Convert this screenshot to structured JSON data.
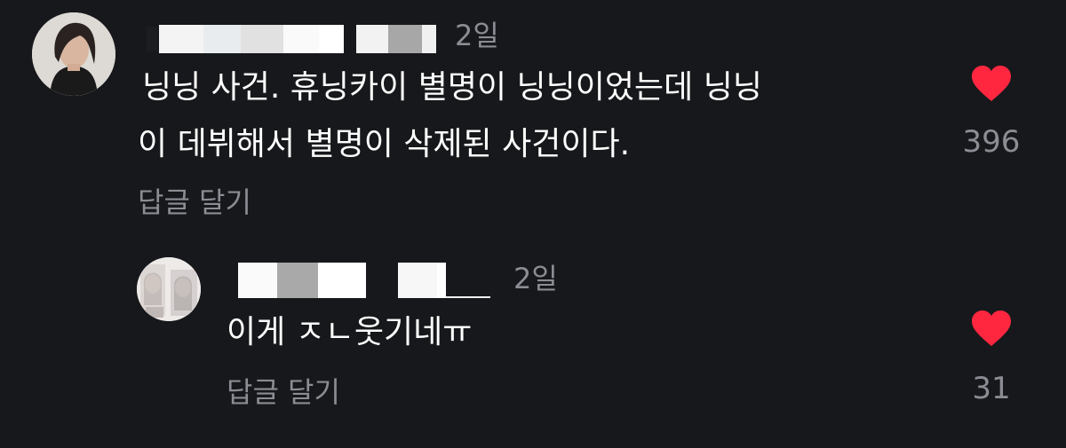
{
  "comments": [
    {
      "time": "2일",
      "text_line1": "닝닝 사건. 휴닝카이 별명이 닝닝이었는데 닝닝",
      "text_line2": "이 데뷔해서 별명이 삭제된 사건이다.",
      "reply_label": "답글 달기",
      "likes": "396"
    },
    {
      "time": "2일",
      "text": "이게 ㅈㄴ웃기네ㅠ",
      "reply_label": "답글 달기",
      "likes": "31"
    }
  ],
  "colors": {
    "background": "#17181b",
    "heart": "#ff2740",
    "muted": "#8a8d93",
    "text": "#ffffff"
  },
  "icons": [
    "heart-icon"
  ]
}
